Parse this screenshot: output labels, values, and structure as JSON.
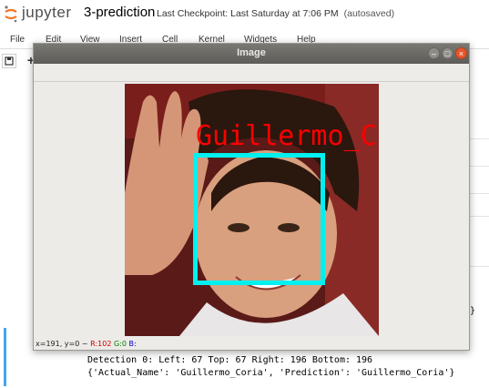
{
  "jupyter": {
    "logo_text": "jupyter",
    "notebook_name": "3-prediction",
    "checkpoint": "Last Checkpoint: Last Saturday at 7:06 PM",
    "autosaved": "(autosaved)",
    "menu": [
      "File",
      "Edit",
      "View",
      "Insert",
      "Cell",
      "Kernel",
      "Widgets",
      "Help"
    ]
  },
  "window": {
    "title": "Image",
    "status": {
      "coords": "x=191, y=0",
      "sep": "~",
      "r": "R:102",
      "g": "G:0",
      "b": "B:"
    },
    "face_label": "Guillermo_C"
  },
  "output": {
    "line1": "Detection 0: Left: 67 Top: 67 Right: 196 Bottom: 196",
    "line2": "{'Actual_Name': 'Guillermo_Coria', 'Prediction': 'Guillermo_Coria'}",
    "brace": "}"
  },
  "colors": {
    "box": "#00f0f0",
    "label": "#ff0000",
    "cell_bar": "#42a5f5"
  }
}
